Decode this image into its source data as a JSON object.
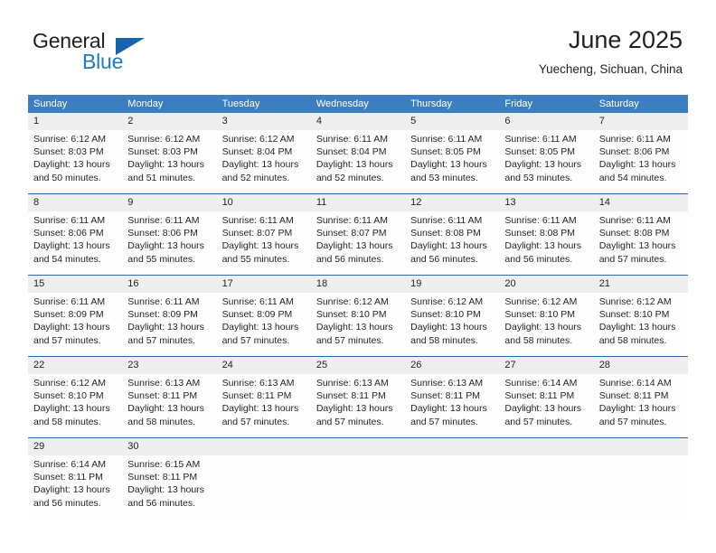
{
  "brand": {
    "word_one": "General",
    "word_two": "Blue",
    "triangle_icon": "brand-triangle-icon"
  },
  "header": {
    "title": "June 2025",
    "location": "Yuecheng, Sichuan, China"
  },
  "colors": {
    "header_blue": "#3c7fc1",
    "week_divider_blue": "#2a69ab",
    "day_number_band": "#eeeeee",
    "brand_blue": "#1f7ac4",
    "text": "#231f20"
  },
  "weekday_headers": [
    "Sunday",
    "Monday",
    "Tuesday",
    "Wednesday",
    "Thursday",
    "Friday",
    "Saturday"
  ],
  "weeks": [
    {
      "days": [
        {
          "number": "1",
          "lines": [
            "Sunrise: 6:12 AM",
            "Sunset: 8:03 PM",
            "Daylight: 13 hours",
            "and 50 minutes."
          ]
        },
        {
          "number": "2",
          "lines": [
            "Sunrise: 6:12 AM",
            "Sunset: 8:03 PM",
            "Daylight: 13 hours",
            "and 51 minutes."
          ]
        },
        {
          "number": "3",
          "lines": [
            "Sunrise: 6:12 AM",
            "Sunset: 8:04 PM",
            "Daylight: 13 hours",
            "and 52 minutes."
          ]
        },
        {
          "number": "4",
          "lines": [
            "Sunrise: 6:11 AM",
            "Sunset: 8:04 PM",
            "Daylight: 13 hours",
            "and 52 minutes."
          ]
        },
        {
          "number": "5",
          "lines": [
            "Sunrise: 6:11 AM",
            "Sunset: 8:05 PM",
            "Daylight: 13 hours",
            "and 53 minutes."
          ]
        },
        {
          "number": "6",
          "lines": [
            "Sunrise: 6:11 AM",
            "Sunset: 8:05 PM",
            "Daylight: 13 hours",
            "and 53 minutes."
          ]
        },
        {
          "number": "7",
          "lines": [
            "Sunrise: 6:11 AM",
            "Sunset: 8:06 PM",
            "Daylight: 13 hours",
            "and 54 minutes."
          ]
        }
      ]
    },
    {
      "days": [
        {
          "number": "8",
          "lines": [
            "Sunrise: 6:11 AM",
            "Sunset: 8:06 PM",
            "Daylight: 13 hours",
            "and 54 minutes."
          ]
        },
        {
          "number": "9",
          "lines": [
            "Sunrise: 6:11 AM",
            "Sunset: 8:06 PM",
            "Daylight: 13 hours",
            "and 55 minutes."
          ]
        },
        {
          "number": "10",
          "lines": [
            "Sunrise: 6:11 AM",
            "Sunset: 8:07 PM",
            "Daylight: 13 hours",
            "and 55 minutes."
          ]
        },
        {
          "number": "11",
          "lines": [
            "Sunrise: 6:11 AM",
            "Sunset: 8:07 PM",
            "Daylight: 13 hours",
            "and 56 minutes."
          ]
        },
        {
          "number": "12",
          "lines": [
            "Sunrise: 6:11 AM",
            "Sunset: 8:08 PM",
            "Daylight: 13 hours",
            "and 56 minutes."
          ]
        },
        {
          "number": "13",
          "lines": [
            "Sunrise: 6:11 AM",
            "Sunset: 8:08 PM",
            "Daylight: 13 hours",
            "and 56 minutes."
          ]
        },
        {
          "number": "14",
          "lines": [
            "Sunrise: 6:11 AM",
            "Sunset: 8:08 PM",
            "Daylight: 13 hours",
            "and 57 minutes."
          ]
        }
      ]
    },
    {
      "days": [
        {
          "number": "15",
          "lines": [
            "Sunrise: 6:11 AM",
            "Sunset: 8:09 PM",
            "Daylight: 13 hours",
            "and 57 minutes."
          ]
        },
        {
          "number": "16",
          "lines": [
            "Sunrise: 6:11 AM",
            "Sunset: 8:09 PM",
            "Daylight: 13 hours",
            "and 57 minutes."
          ]
        },
        {
          "number": "17",
          "lines": [
            "Sunrise: 6:11 AM",
            "Sunset: 8:09 PM",
            "Daylight: 13 hours",
            "and 57 minutes."
          ]
        },
        {
          "number": "18",
          "lines": [
            "Sunrise: 6:12 AM",
            "Sunset: 8:10 PM",
            "Daylight: 13 hours",
            "and 57 minutes."
          ]
        },
        {
          "number": "19",
          "lines": [
            "Sunrise: 6:12 AM",
            "Sunset: 8:10 PM",
            "Daylight: 13 hours",
            "and 58 minutes."
          ]
        },
        {
          "number": "20",
          "lines": [
            "Sunrise: 6:12 AM",
            "Sunset: 8:10 PM",
            "Daylight: 13 hours",
            "and 58 minutes."
          ]
        },
        {
          "number": "21",
          "lines": [
            "Sunrise: 6:12 AM",
            "Sunset: 8:10 PM",
            "Daylight: 13 hours",
            "and 58 minutes."
          ]
        }
      ]
    },
    {
      "days": [
        {
          "number": "22",
          "lines": [
            "Sunrise: 6:12 AM",
            "Sunset: 8:10 PM",
            "Daylight: 13 hours",
            "and 58 minutes."
          ]
        },
        {
          "number": "23",
          "lines": [
            "Sunrise: 6:13 AM",
            "Sunset: 8:11 PM",
            "Daylight: 13 hours",
            "and 58 minutes."
          ]
        },
        {
          "number": "24",
          "lines": [
            "Sunrise: 6:13 AM",
            "Sunset: 8:11 PM",
            "Daylight: 13 hours",
            "and 57 minutes."
          ]
        },
        {
          "number": "25",
          "lines": [
            "Sunrise: 6:13 AM",
            "Sunset: 8:11 PM",
            "Daylight: 13 hours",
            "and 57 minutes."
          ]
        },
        {
          "number": "26",
          "lines": [
            "Sunrise: 6:13 AM",
            "Sunset: 8:11 PM",
            "Daylight: 13 hours",
            "and 57 minutes."
          ]
        },
        {
          "number": "27",
          "lines": [
            "Sunrise: 6:14 AM",
            "Sunset: 8:11 PM",
            "Daylight: 13 hours",
            "and 57 minutes."
          ]
        },
        {
          "number": "28",
          "lines": [
            "Sunrise: 6:14 AM",
            "Sunset: 8:11 PM",
            "Daylight: 13 hours",
            "and 57 minutes."
          ]
        }
      ]
    },
    {
      "days": [
        {
          "number": "29",
          "lines": [
            "Sunrise: 6:14 AM",
            "Sunset: 8:11 PM",
            "Daylight: 13 hours",
            "and 56 minutes."
          ]
        },
        {
          "number": "30",
          "lines": [
            "Sunrise: 6:15 AM",
            "Sunset: 8:11 PM",
            "Daylight: 13 hours",
            "and 56 minutes."
          ]
        },
        {
          "number": "",
          "lines": []
        },
        {
          "number": "",
          "lines": []
        },
        {
          "number": "",
          "lines": []
        },
        {
          "number": "",
          "lines": []
        },
        {
          "number": "",
          "lines": []
        }
      ]
    }
  ]
}
